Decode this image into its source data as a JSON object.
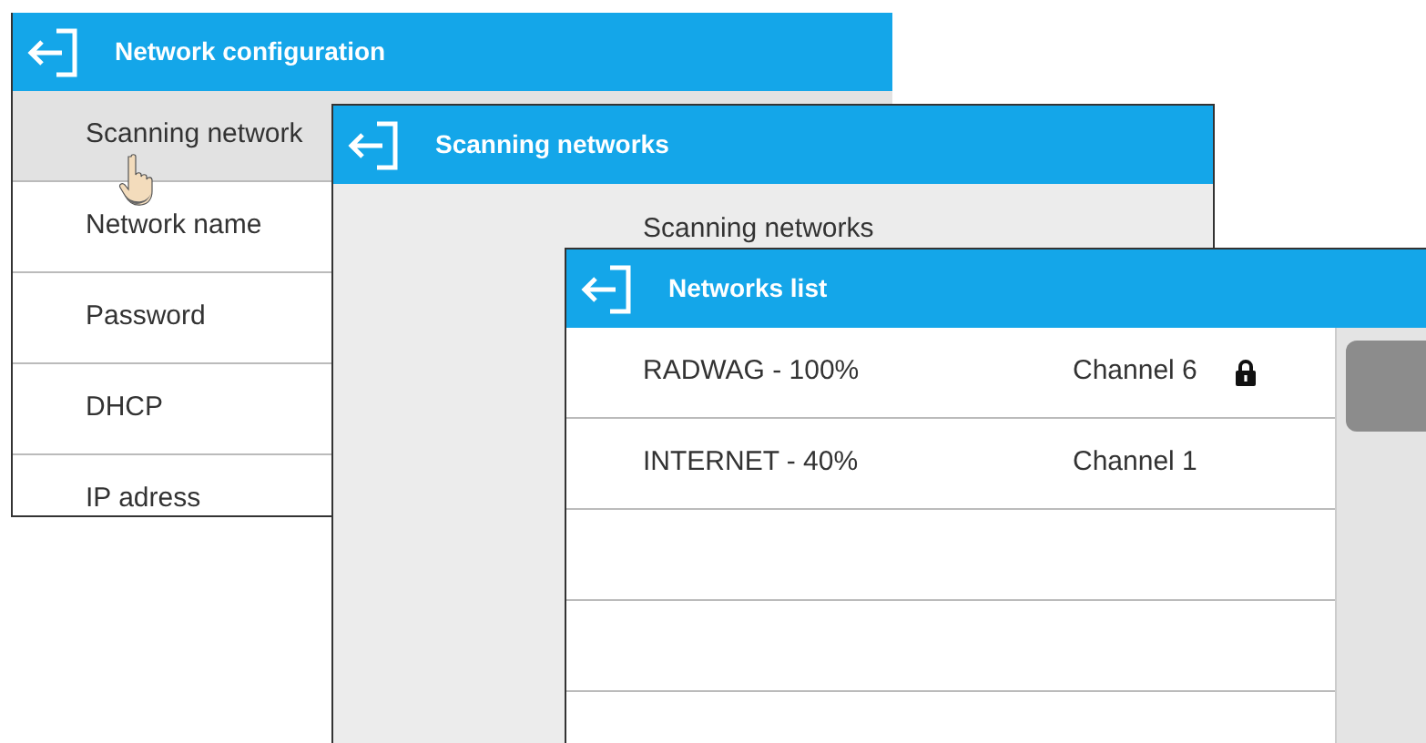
{
  "windows": [
    {
      "title": "Network configuration",
      "items": [
        {
          "label": "Scanning network",
          "selected": true
        },
        {
          "label": "Network name",
          "selected": false
        },
        {
          "label": "Password",
          "selected": false
        },
        {
          "label": "DHCP",
          "selected": false
        },
        {
          "label": "IP adress",
          "selected": false
        }
      ]
    },
    {
      "title": "Scanning networks",
      "message": "Scanning networks"
    },
    {
      "title": "Networks list",
      "networks": [
        {
          "name": "RADWAG - 100%",
          "channel": "Channel 6",
          "locked": true
        },
        {
          "name": "INTERNET - 40%",
          "channel": "Channel 1",
          "locked": false
        }
      ]
    }
  ]
}
